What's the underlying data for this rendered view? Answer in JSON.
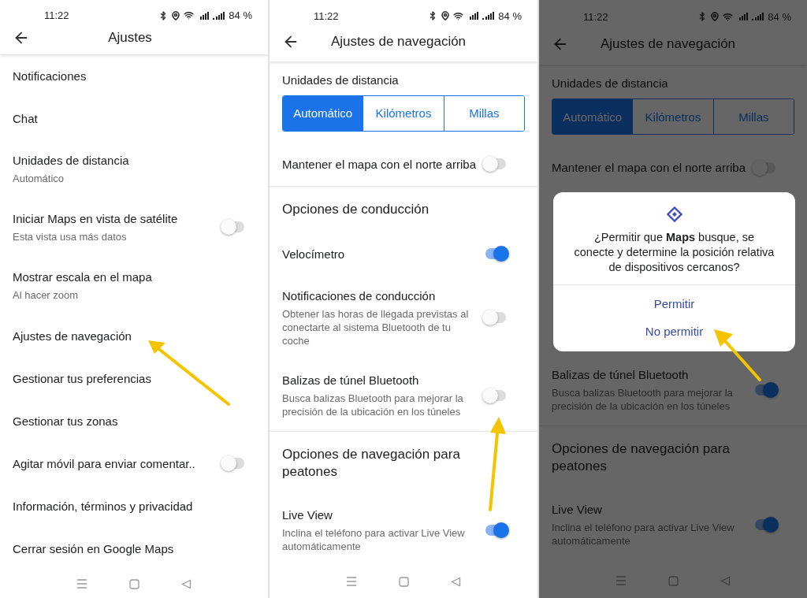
{
  "screens": [
    {
      "kind": "settings",
      "dimmed": false,
      "status": {
        "time": "11:22",
        "battery": "84 %"
      },
      "title": "Ajustes",
      "rows": [
        {
          "kind": "item",
          "title": "Notificaciones"
        },
        {
          "kind": "item",
          "title": "Chat"
        },
        {
          "kind": "item",
          "title": "Unidades de distancia",
          "subtitle": "Automático"
        },
        {
          "kind": "toggle",
          "title": "Iniciar Maps en vista de satélite",
          "subtitle": "Esta vista usa más datos",
          "on": false
        },
        {
          "kind": "item",
          "title": "Mostrar escala en el mapa",
          "subtitle": "Al hacer zoom"
        },
        {
          "kind": "item",
          "title": "Ajustes de navegación"
        },
        {
          "kind": "item",
          "title": "Gestionar tus preferencias"
        },
        {
          "kind": "item",
          "title": "Gestionar tus zonas"
        },
        {
          "kind": "toggle",
          "title": "Agitar móvil para enviar comentar..",
          "on": false
        },
        {
          "kind": "item",
          "title": "Información, términos y privacidad"
        },
        {
          "kind": "item",
          "title": "Cerrar sesión en Google Maps"
        }
      ]
    },
    {
      "kind": "navigation",
      "dimmed": false,
      "status": {
        "time": "11:22",
        "battery": "84 %"
      },
      "title": "Ajustes de navegación",
      "rows": [
        {
          "kind": "label",
          "title": "Unidades de distancia"
        },
        {
          "kind": "segmented",
          "options": [
            {
              "label": "Automático",
              "selected": true
            },
            {
              "label": "Kilómetros",
              "selected": false
            },
            {
              "label": "Millas",
              "selected": false
            }
          ]
        },
        {
          "kind": "toggle",
          "title": "Mantener el mapa con el norte arriba",
          "on": false
        },
        {
          "kind": "section",
          "title": "Opciones de conducción"
        },
        {
          "kind": "toggle",
          "title": "Velocímetro",
          "on": true
        },
        {
          "kind": "toggle",
          "title": "Notificaciones de conducción",
          "subtitle": "Obtener las horas de llegada previstas al conectarte al sistema Bluetooth de tu coche",
          "on": false
        },
        {
          "kind": "toggle",
          "title": "Balizas de túnel Bluetooth",
          "subtitle": "Busca balizas Bluetooth para mejorar la precisión de la ubicación en los túneles",
          "on": false
        },
        {
          "kind": "section",
          "title": "Opciones de navegación para peatones"
        },
        {
          "kind": "toggle",
          "title": "Live View",
          "subtitle": "Inclina el teléfono para activar Live View automáticamente",
          "on": true
        }
      ]
    },
    {
      "kind": "navigation",
      "dimmed": true,
      "status": {
        "time": "11:22",
        "battery": "84 %"
      },
      "title": "Ajustes de navegación",
      "rows": [
        {
          "kind": "label",
          "title": "Unidades de distancia"
        },
        {
          "kind": "segmented",
          "options": [
            {
              "label": "Automático",
              "selected": true
            },
            {
              "label": "Kilómetros",
              "selected": false
            },
            {
              "label": "Millas",
              "selected": false
            }
          ]
        },
        {
          "kind": "toggle",
          "title": "Mantener el mapa con el norte arriba",
          "on": false
        },
        {
          "kind": "dialog",
          "message": "¿Permitir que **Maps** busque, se conecte y determine la posición relativa de dispositivos cercanos?",
          "buttons": [
            "Permitir",
            "No permitir"
          ]
        },
        {
          "kind": "toggle",
          "title": "Balizas de túnel Bluetooth",
          "subtitle": "Busca balizas Bluetooth para mejorar la precisión de la ubicación en los túneles",
          "on": true
        },
        {
          "kind": "section",
          "title": "Opciones de navegación para peatones"
        },
        {
          "kind": "toggle",
          "title": "Live View",
          "subtitle": "Inclina el teléfono para activar Live View automáticamente",
          "on": true
        }
      ]
    }
  ]
}
